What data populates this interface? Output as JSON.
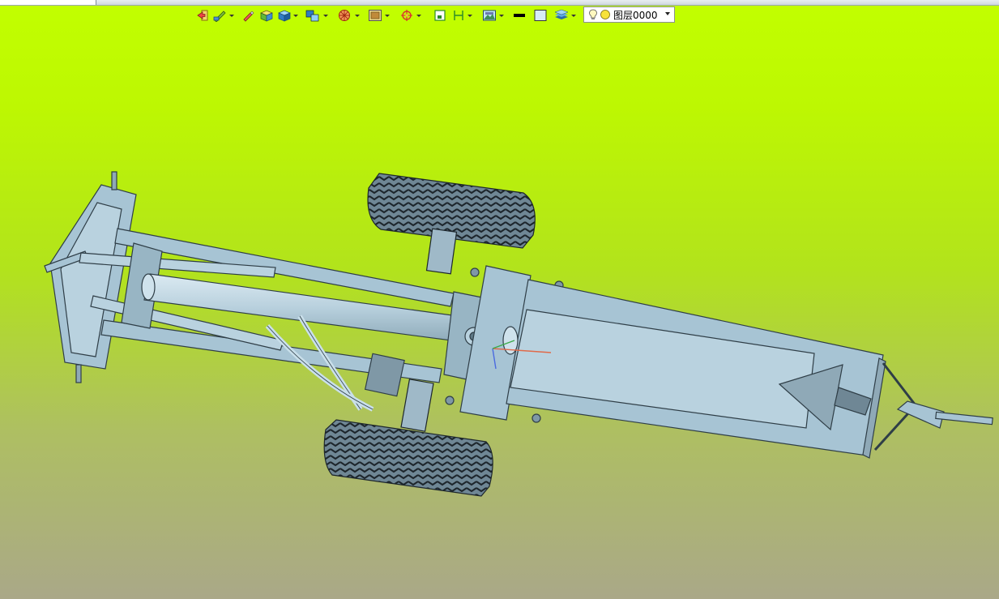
{
  "toolbar": {
    "buttons": [
      {
        "name": "exit-sketch-button",
        "icon": "exit-arrow-icon",
        "dropdown": false
      },
      {
        "name": "sketch-tools-button",
        "icon": "sketch-pencil-icon",
        "dropdown": true
      },
      {
        "name": "measure-button",
        "icon": "pen-measure-icon",
        "dropdown": false
      },
      {
        "name": "solid-shading-button",
        "icon": "shaded-cube-icon",
        "dropdown": false
      },
      {
        "name": "display-mode-button",
        "icon": "blue-cube-icon",
        "dropdown": true
      },
      {
        "name": "view-orientation-button",
        "icon": "view-cubes-icon",
        "dropdown": true
      },
      {
        "name": "render-style-button",
        "icon": "sphere-render-icon",
        "dropdown": true
      },
      {
        "name": "texture-button",
        "icon": "texture-frame-icon",
        "dropdown": true
      },
      {
        "name": "snap-point-button",
        "icon": "target-snap-icon",
        "dropdown": true
      },
      {
        "name": "zoom-window-button",
        "icon": "zoom-window-icon",
        "dropdown": false
      },
      {
        "name": "dimension-button",
        "icon": "dimension-bracket-icon",
        "dropdown": true
      },
      {
        "name": "scene-settings-button",
        "icon": "scene-picture-icon",
        "dropdown": true
      },
      {
        "name": "line-color-button",
        "icon": "black-line-icon",
        "dropdown": false
      },
      {
        "name": "fill-color-button",
        "icon": "fill-square-icon",
        "dropdown": false
      },
      {
        "name": "layers-button",
        "icon": "layers-stack-icon",
        "dropdown": true
      }
    ]
  },
  "layer_selector": {
    "current_layer": "图层0000",
    "bulb_icon": "lightbulb-icon",
    "state_icon": "yellow-circle-icon"
  },
  "colors": {
    "background_top": "#c2ff00",
    "background_bottom": "#aaa888",
    "model_fill": "#a7c4d4",
    "model_stroke": "#2f3e47"
  }
}
